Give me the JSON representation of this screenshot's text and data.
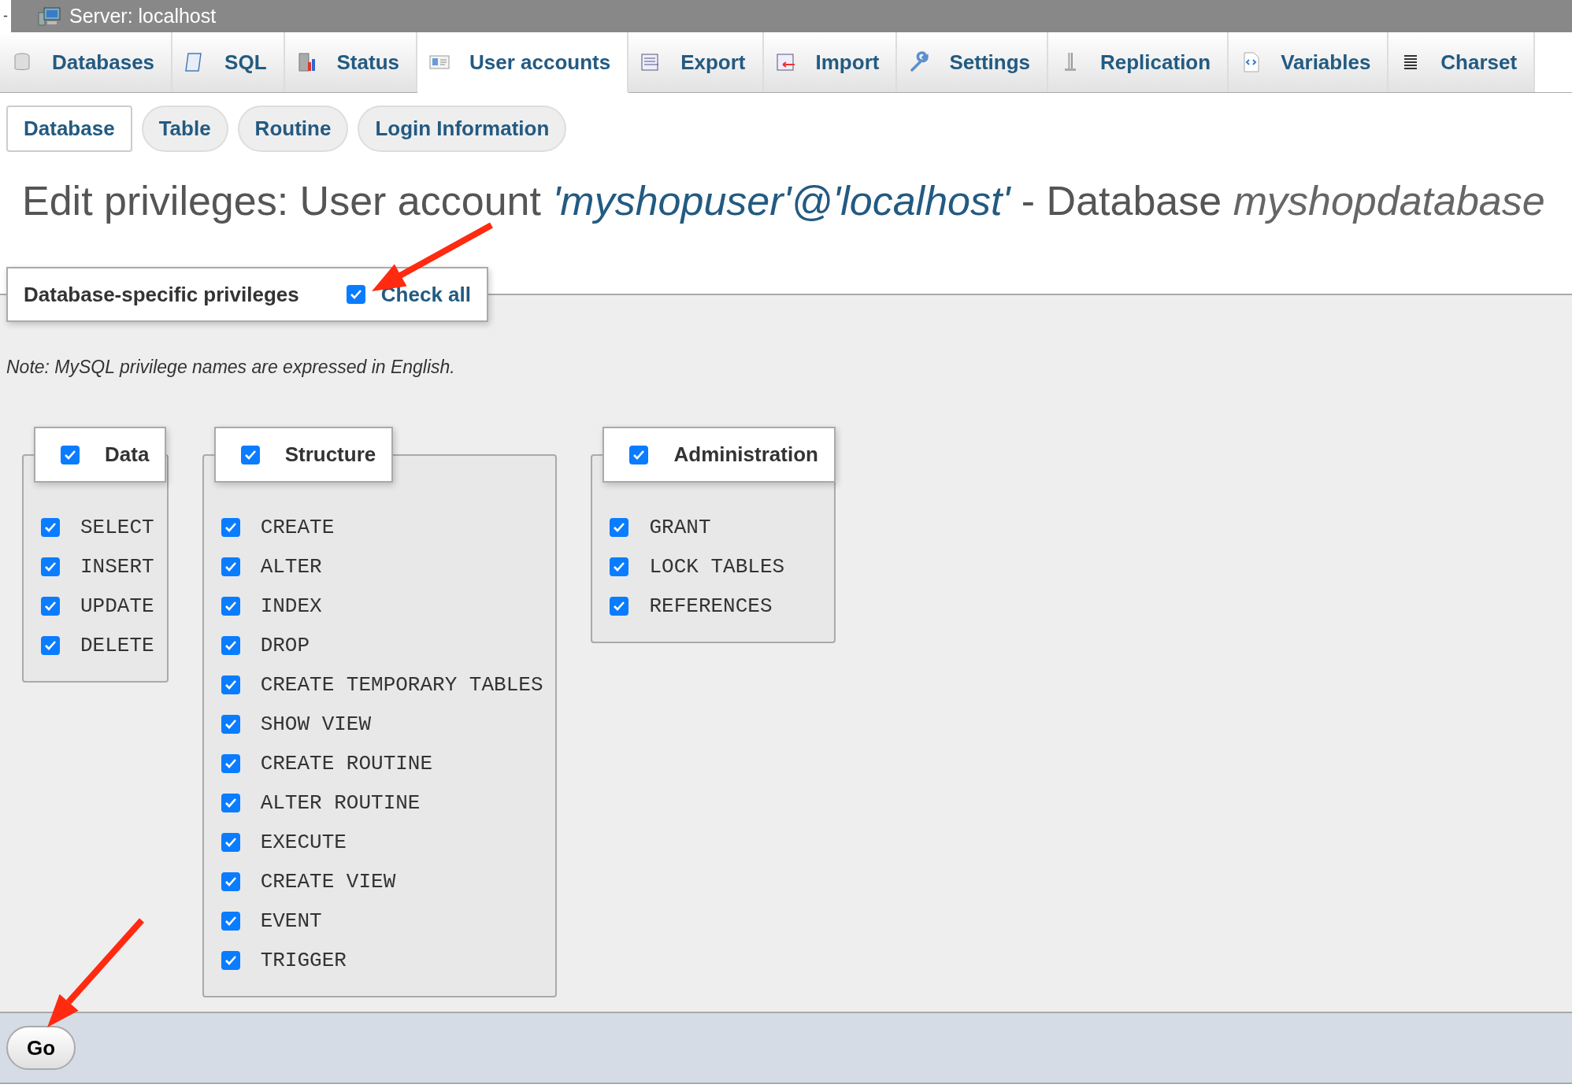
{
  "server_bar": {
    "collapse": "-",
    "title": "Server: localhost"
  },
  "tabs": [
    {
      "label": "Databases",
      "selected": false
    },
    {
      "label": "SQL",
      "selected": false
    },
    {
      "label": "Status",
      "selected": false
    },
    {
      "label": "User accounts",
      "selected": true
    },
    {
      "label": "Export",
      "selected": false
    },
    {
      "label": "Import",
      "selected": false
    },
    {
      "label": "Settings",
      "selected": false
    },
    {
      "label": "Replication",
      "selected": false
    },
    {
      "label": "Variables",
      "selected": false
    },
    {
      "label": "Charset",
      "selected": false
    }
  ],
  "subtabs": [
    {
      "label": "Database",
      "selected": true
    },
    {
      "label": "Table",
      "selected": false
    },
    {
      "label": "Routine",
      "selected": false
    },
    {
      "label": "Login Information",
      "selected": false
    }
  ],
  "heading": {
    "prefix": "Edit privileges: User account",
    "user": "'myshopuser'@'localhost'",
    "middle": "- Database",
    "database": "myshopdatabase"
  },
  "privileges": {
    "legend": "Database-specific privileges",
    "check_all": {
      "label": "Check all",
      "checked": true
    }
  },
  "note": "Note: MySQL privilege names are expressed in English.",
  "groups": [
    {
      "title": "Data",
      "checked": true,
      "items": [
        {
          "name": "SELECT",
          "checked": true
        },
        {
          "name": "INSERT",
          "checked": true
        },
        {
          "name": "UPDATE",
          "checked": true
        },
        {
          "name": "DELETE",
          "checked": true
        }
      ]
    },
    {
      "title": "Structure",
      "checked": true,
      "items": [
        {
          "name": "CREATE",
          "checked": true
        },
        {
          "name": "ALTER",
          "checked": true
        },
        {
          "name": "INDEX",
          "checked": true
        },
        {
          "name": "DROP",
          "checked": true
        },
        {
          "name": "CREATE TEMPORARY TABLES",
          "checked": true
        },
        {
          "name": "SHOW VIEW",
          "checked": true
        },
        {
          "name": "CREATE ROUTINE",
          "checked": true
        },
        {
          "name": "ALTER ROUTINE",
          "checked": true
        },
        {
          "name": "EXECUTE",
          "checked": true
        },
        {
          "name": "CREATE VIEW",
          "checked": true
        },
        {
          "name": "EVENT",
          "checked": true
        },
        {
          "name": "TRIGGER",
          "checked": true
        }
      ]
    },
    {
      "title": "Administration",
      "checked": true,
      "items": [
        {
          "name": "GRANT",
          "checked": true
        },
        {
          "name": "LOCK TABLES",
          "checked": true
        },
        {
          "name": "REFERENCES",
          "checked": true
        }
      ]
    }
  ],
  "footer": {
    "button": "Go"
  }
}
